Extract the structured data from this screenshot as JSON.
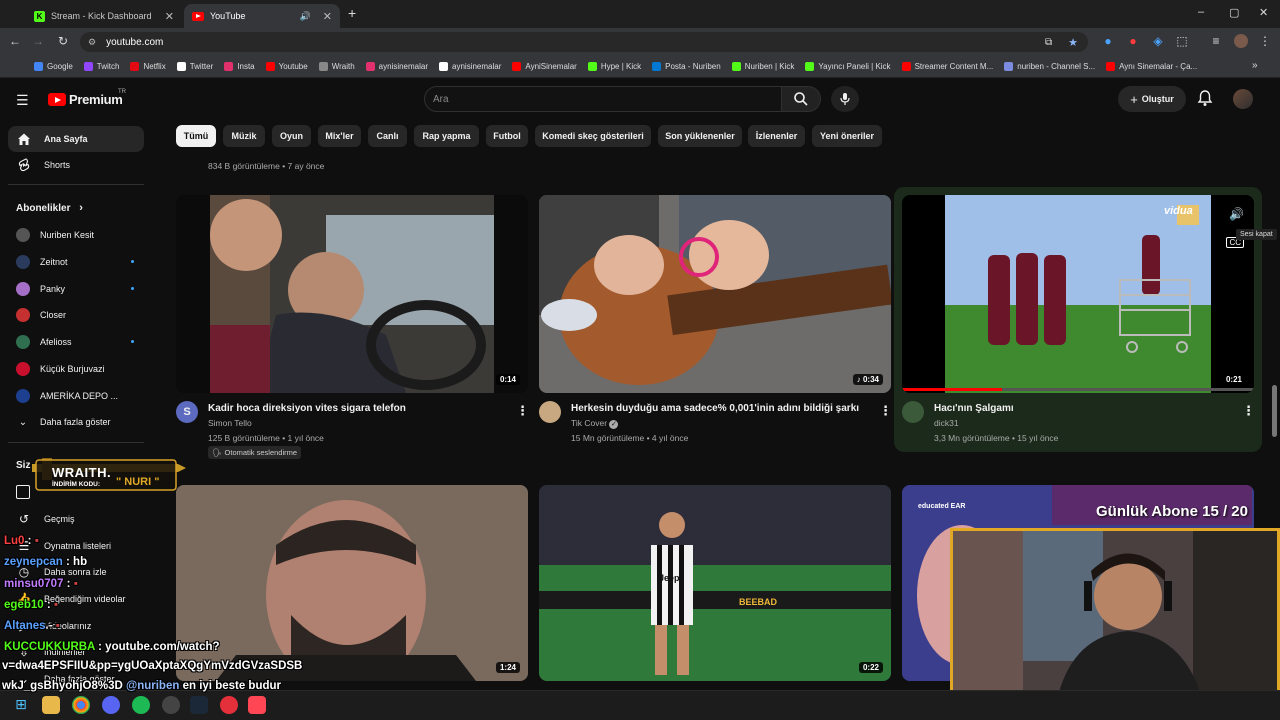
{
  "browser": {
    "tabs": [
      {
        "label": "Stream - Kick Dashboard",
        "close": "✕"
      },
      {
        "label": "YouTube",
        "close": "✕"
      }
    ],
    "new_tab": "+",
    "url": "youtube.com",
    "window_controls": [
      "–",
      "▢",
      "✕"
    ],
    "bookmarks": [
      {
        "label": "Google",
        "color": "#4285f4"
      },
      {
        "label": "Twitch",
        "color": "#9146ff"
      },
      {
        "label": "Netflix",
        "color": "#e50914"
      },
      {
        "label": "Twitter",
        "color": "#ffffff"
      },
      {
        "label": "Insta",
        "color": "#e1306c"
      },
      {
        "label": "Youtube",
        "color": "#ff0000"
      },
      {
        "label": "Wraith",
        "color": "#888888"
      },
      {
        "label": "aynisinemalar",
        "color": "#e1306c"
      },
      {
        "label": "aynisinemalar",
        "color": "#ffffff"
      },
      {
        "label": "AyniSinemalar",
        "color": "#ff0000"
      },
      {
        "label": "Hype | Kick",
        "color": "#53fc18"
      },
      {
        "label": "Posta - Nuriben",
        "color": "#0078d4"
      },
      {
        "label": "Nuriben | Kick",
        "color": "#53fc18"
      },
      {
        "label": "Yayıncı Paneli | Kick",
        "color": "#53fc18"
      },
      {
        "label": "Streamer Content M...",
        "color": "#ff0000"
      },
      {
        "label": "nuriben - Channel S...",
        "color": "#7b8cde"
      },
      {
        "label": "Aynı Sinemalar - Ça...",
        "color": "#ff0000"
      }
    ],
    "more_bookmarks": "»"
  },
  "youtube": {
    "logo_text": "Premium",
    "logo_sup": "TR",
    "search_placeholder": "Ara",
    "create_label": "Oluştur",
    "chips": [
      "Tümü",
      "Müzik",
      "Oyun",
      "Mix'ler",
      "Canlı",
      "Rap yapma",
      "Futbol",
      "Komedi skeç gösterileri",
      "Son yüklenenler",
      "İzlenenler",
      "Yeni öneriler"
    ],
    "sidebar": {
      "home": "Ana Sayfa",
      "shorts": "Shorts",
      "subs_header": "Abonelikler",
      "subscriptions": [
        {
          "name": "Nuriben Kesit",
          "color": "#555"
        },
        {
          "name": "Zeitnot",
          "color": "#2a3b5e"
        },
        {
          "name": "Panky",
          "color": "#a56fc7"
        },
        {
          "name": "Closer",
          "color": "#c53030"
        },
        {
          "name": "Afelioss",
          "color": "#2f6f4f"
        },
        {
          "name": "Küçük Burjuvazi",
          "color": "#c8102e"
        },
        {
          "name": "AMERİKA DEPO ...",
          "color": "#1d3f8f"
        }
      ],
      "show_more": "Daha fazla göster",
      "you_header": "Siz",
      "you_items": [
        "Geçmiş",
        "Oynatma listeleri",
        "Daha sonra izle",
        "Beğendiğim videolar",
        "Videolarınız",
        "İndirilenler",
        "Daha fazla göster"
      ]
    },
    "top_meta": "834 B görüntüleme • 7 ay önce",
    "videos_row1": [
      {
        "title": "Kadir hoca direksiyon vites sigara telefon",
        "channel": "Simon Tello",
        "meta": "125 B görüntüleme • 1 yıl önce",
        "badge": "Otomatik seslendirme",
        "duration": "0:14",
        "avatar": "S"
      },
      {
        "title": "Herkesin duyduğu ama sadece% 0,001'inin adını bildiği şarkı",
        "channel": "Tik Cover",
        "verified": "✓",
        "meta": "15 Mn görüntüleme • 4 yıl önce",
        "duration": "0:34",
        "avatar": ""
      },
      {
        "title": "Hacı'nın Şalgamı",
        "channel": "dick31",
        "meta": "3,3 Mn görüntüleme • 15 yıl önce",
        "duration": "0:21",
        "avatar": "",
        "tooltip": "Sesi kapat",
        "thumb_brand": "vidua"
      }
    ],
    "videos_row2": [
      {
        "duration": "1:24"
      },
      {
        "duration": "0:22",
        "thumb_text": "Jeep",
        "thumb_ad": "BEEBAD"
      },
      {
        "thumb_text": "educated EAR"
      }
    ]
  },
  "overlay": {
    "wraith_title": "WRAITH.",
    "wraith_code_label": "İNDİRİM KODU:",
    "wraith_code": "\" NURI \"",
    "sub_goal": "Günlük Abone 15 / 20",
    "chat": [
      {
        "user": "Lu0",
        "sep": " : ",
        "msg": "",
        "color": "#ff4040"
      },
      {
        "user": "zeynepcan",
        "sep": " : ",
        "msg": "hb",
        "color": "#5aa0ff"
      },
      {
        "user": "minsu0707",
        "sep": " : ",
        "msg": "",
        "color": "#c27cff"
      },
      {
        "user": "egeb10",
        "sep": " : ",
        "msg": "",
        "color": "#53fc18"
      },
      {
        "user": "Altanes",
        "sep": " - ",
        "msg": "",
        "color": "#5aa0ff"
      },
      {
        "user": "KUCCUKKURBA",
        "sep": " : ",
        "msg": "youtube.com/watch?",
        "color": "#53fc18"
      },
      {
        "user": "",
        "sep": "",
        "msg": "v=dwa4EPSFIIU&pp=ygUOaXptaXQgYmVzdGVzaSDSB",
        "color": "#ffffff"
      },
      {
        "user": "",
        "sep": "",
        "msg": "wkJ_gsBhyohjO8%3D",
        "mention": "@nuriben",
        "tail": "en iyi beste budur",
        "color": "#ffffff"
      }
    ]
  },
  "colors": {
    "yt_red": "#ff0000",
    "kick_green": "#53fc18",
    "bg": "#0f0f0f",
    "chip": "#272727",
    "overlay_gold": "#e0a825"
  }
}
